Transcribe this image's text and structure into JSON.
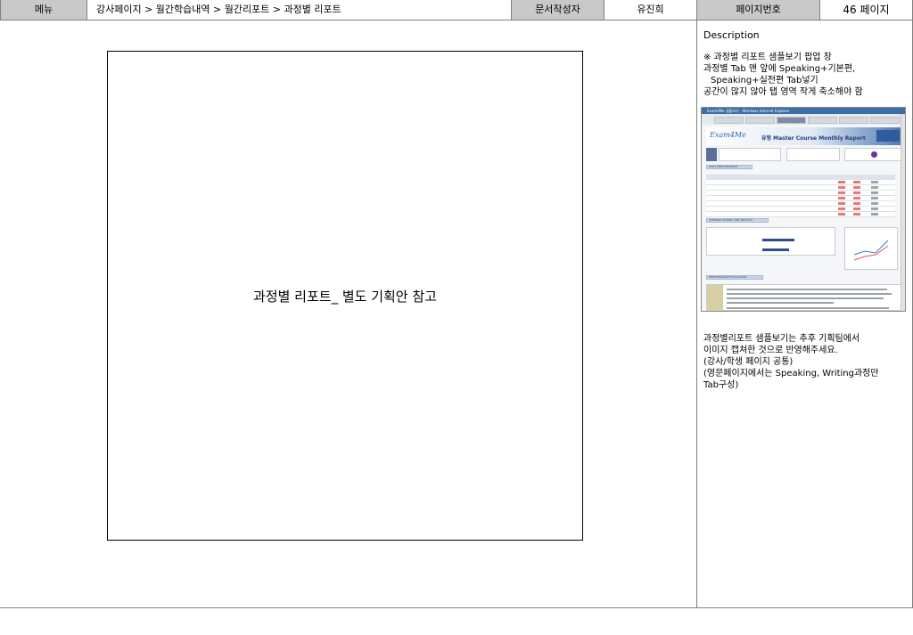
{
  "header": {
    "menu_label": "메뉴",
    "breadcrumb": "강사페이지 > 월간학습내역 > 월간리포트 > 과정별 리포트",
    "author_label": "문서작성자",
    "author_name": "유진희",
    "page_label": "페이지번호",
    "page_value": "46 페이지"
  },
  "main": {
    "placeholder_text": "과정별 리포트_ 별도 기획안 참고"
  },
  "description": {
    "title": "Description",
    "notes1": [
      "※ 과정별 리포트 샘플보기 팝업 창",
      "과정별 Tab 맨 앞에 Speaking+기본편,",
      "Speaking+실전편 Tab넣기",
      "공간이 많지 않아 탭 영역 작게 축소해야 함"
    ],
    "notes2": [
      "과정별리포트 샘플보기는 추후 기획팀에서",
      "이미지 캡쳐한 것으로 반영해주세요.",
      "(강사/학생 페이지 공통)",
      "(영문페이지에서는 Speaking, Writing과정만",
      "Tab구성)"
    ]
  },
  "thumbnail": {
    "window_title": "Exam4Me 샘플보기 - Windows Internet Explorer",
    "logo": "Exam4Me",
    "report_title": "유형 Master Course Monthly Report",
    "section_daily": "DAILY PERFORMANCE",
    "section_avg": "AVERAGE SCORES AND RESULTS",
    "section_perf": "PERFORMANCE EVALUATION"
  },
  "colors": {
    "header_gray": "#c9c9c9",
    "border_gray": "#7f7f7f"
  }
}
